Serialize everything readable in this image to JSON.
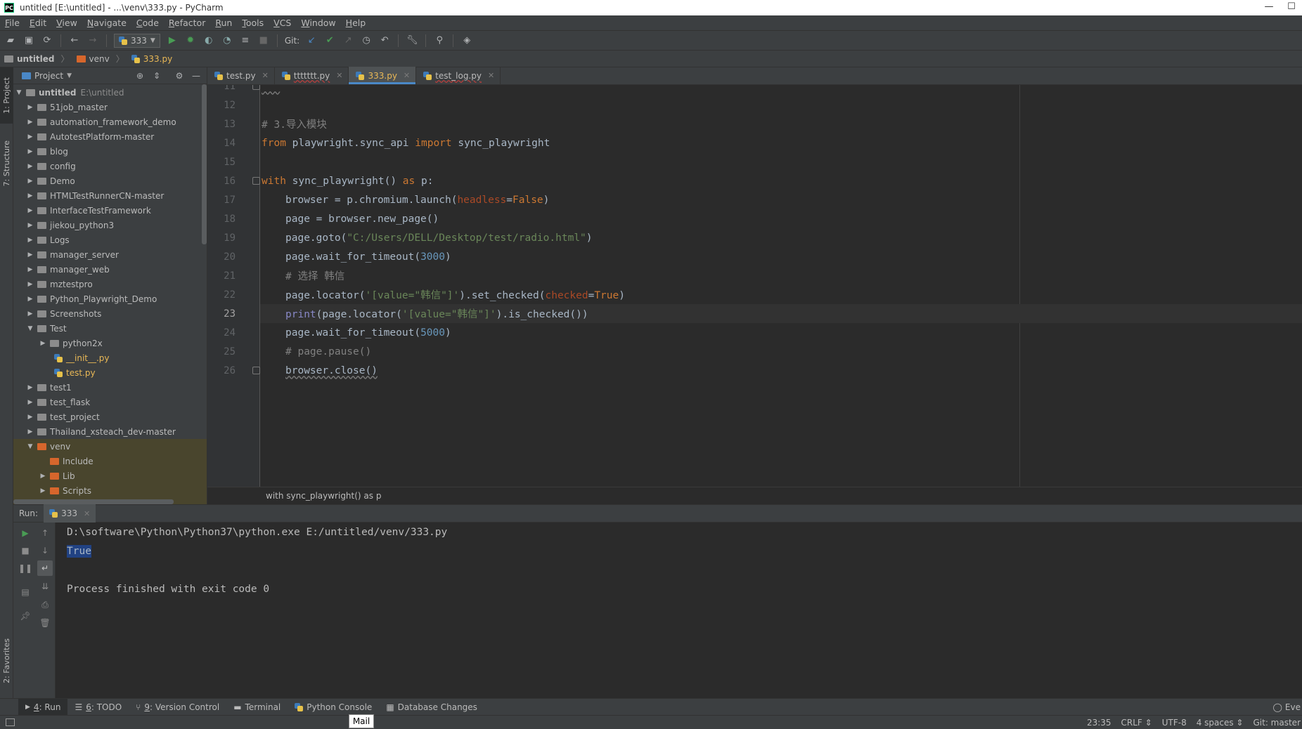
{
  "window": {
    "title": "untitled [E:\\untitled] - ...\\venv\\333.py - PyCharm",
    "app_icon": "PC",
    "minimize_label": "—",
    "maximize_label": "☐"
  },
  "menu": [
    "File",
    "Edit",
    "View",
    "Navigate",
    "Code",
    "Refactor",
    "Run",
    "Tools",
    "VCS",
    "Window",
    "Help"
  ],
  "toolbar": {
    "run_config": "333",
    "git_label": "Git:"
  },
  "navbar": {
    "crumbs": [
      "untitled",
      "venv",
      "333.py"
    ]
  },
  "left_stripe": {
    "project_tab": "1: Project",
    "structure_tab": "7: Structure",
    "favorites_tab": "2: Favorites"
  },
  "project_panel": {
    "header": "Project",
    "root_name": "untitled",
    "root_path": "E:\\untitled",
    "items": [
      "51job_master",
      "automation_framework_demo",
      "AutotestPlatform-master",
      "blog",
      "config",
      "Demo",
      "HTMLTestRunnerCN-master",
      "InterfaceTestFramework",
      "jiekou_python3",
      "Logs",
      "manager_server",
      "manager_web",
      "mztestpro",
      "Python_Playwright_Demo",
      "Screenshots",
      "Test",
      "python2x",
      "__init__.py",
      "test.py",
      "test1",
      "test_flask",
      "test_project",
      "Thailand_xsteach_dev-master",
      "venv",
      "Include",
      "Lib",
      "Scripts"
    ]
  },
  "editor": {
    "tabs": [
      "test.py",
      "ttttttt.py",
      "333.py",
      "test_log.py"
    ],
    "active_tab": "333.py",
    "line_numbers": [
      "11",
      "12",
      "13",
      "14",
      "15",
      "16",
      "17",
      "18",
      "19",
      "20",
      "21",
      "22",
      "23",
      "24",
      "25",
      "26"
    ],
    "code": {
      "l11": "'''",
      "l13_comment": "# 3.导入模块",
      "l14_from": "from",
      "l14_module": " playwright.sync_api ",
      "l14_import": "import",
      "l14_name": " sync_playwright",
      "l16_with": "with",
      "l16_call": " sync_playwright() ",
      "l16_as": "as",
      "l16_p": " p:",
      "l17_a": "browser = p.chromium.launch(",
      "l17_param": "headless",
      "l17_eq": "=",
      "l17_val": "False",
      "l17_close": ")",
      "l18": "page = browser.new_page()",
      "l19_a": "page.goto(",
      "l19_str": "\"C:/Users/DELL/Desktop/test/radio.html\"",
      "l19_close": ")",
      "l20_a": "page.wait_for_timeout(",
      "l20_num": "3000",
      "l20_close": ")",
      "l21_comment": "# 选择 韩信",
      "l22_a": "page.locator(",
      "l22_str": "'[value=\"韩信\"]'",
      "l22_b": ").set_checked(",
      "l22_param": "checked",
      "l22_eq": "=",
      "l22_val": "True",
      "l22_close": ")",
      "l23_print": "print",
      "l23_a": "(page.locator(",
      "l23_str": "'[value=\"韩信\"]'",
      "l23_b": ").is_checked())",
      "l24_a": "page.wait_for_timeout(",
      "l24_num": "5000",
      "l24_close": ")",
      "l25_comment": "# page.pause()",
      "l26": "browser.close()"
    },
    "breadcrumb": "with sync_playwright() as p"
  },
  "run_window": {
    "label": "Run:",
    "tab": "333",
    "output_cmd": "D:\\software\\Python\\Python37\\python.exe E:/untitled/venv/333.py",
    "output_result": "True",
    "output_exit": "Process finished with exit code 0"
  },
  "bottom_tabs": [
    {
      "num": "4",
      "label": ": Run"
    },
    {
      "num": "6",
      "label": ": TODO"
    },
    {
      "num": "9",
      "label": ": Version Control"
    },
    {
      "num": "",
      "label": "Terminal"
    },
    {
      "num": "",
      "label": "Python Console"
    },
    {
      "num": "",
      "label": "Database Changes"
    }
  ],
  "event_log": "Eve",
  "status": {
    "position": "23:35",
    "line_sep": "CRLF ⇕",
    "encoding": "UTF-8",
    "indent": "4 spaces ⇕",
    "git_branch": "Git: master"
  },
  "tooltip": "Mail",
  "colors": {
    "background": "#2b2b2b",
    "panel": "#3c3f41",
    "keyword": "#cc7832",
    "string": "#6a8759",
    "number": "#6897bb",
    "comment": "#808080",
    "accent": "#4a88c7"
  }
}
